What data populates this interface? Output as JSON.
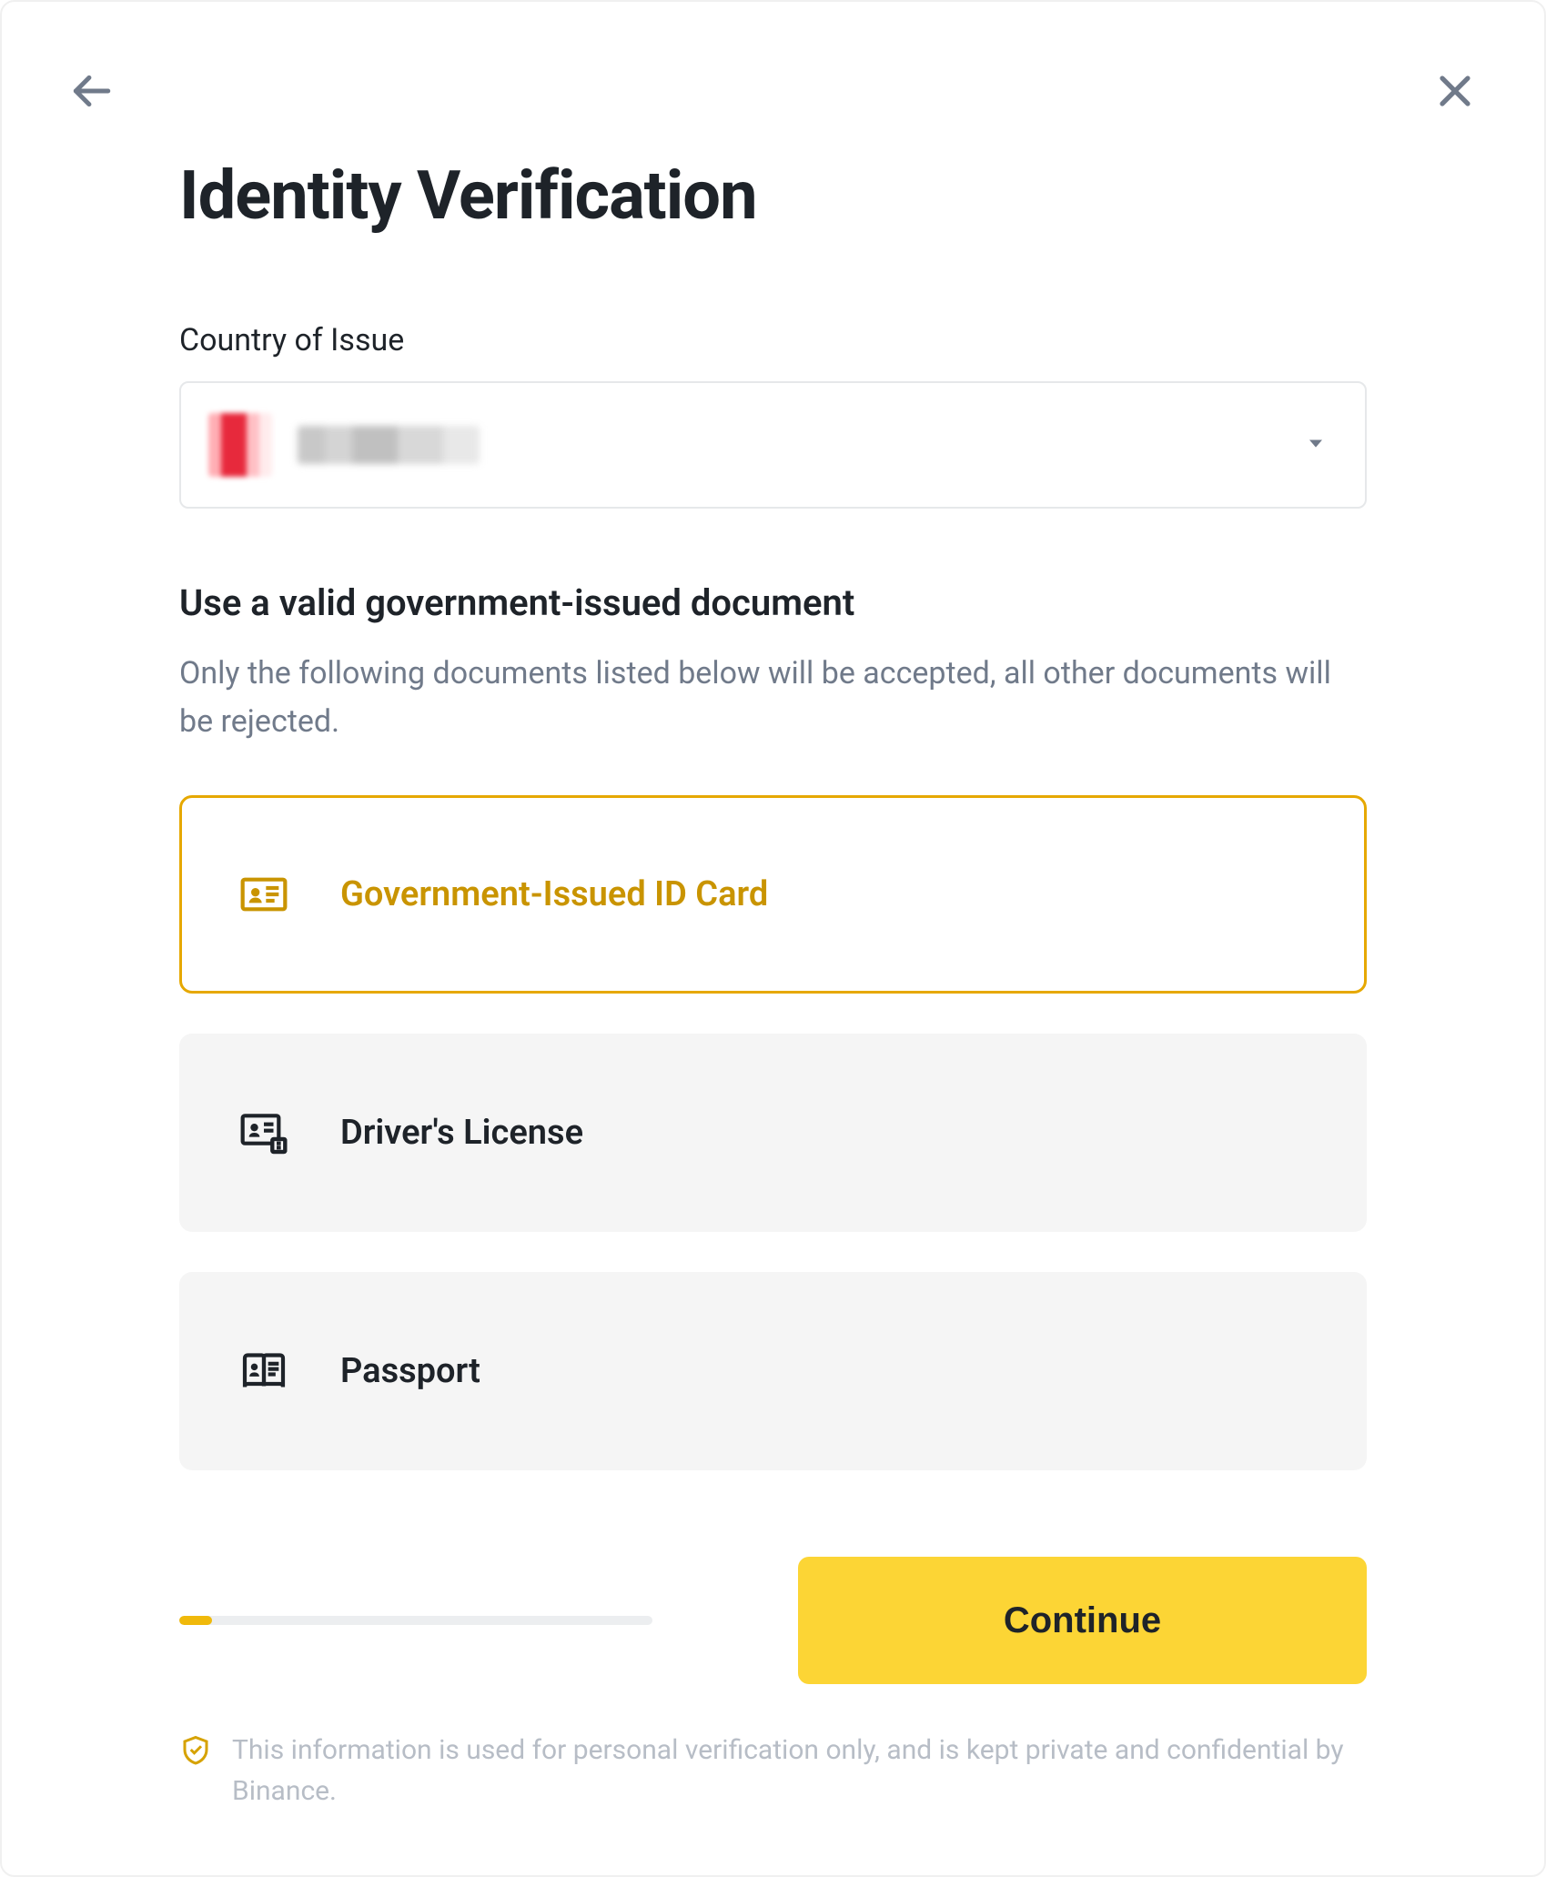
{
  "header": {
    "title": "Identity Verification"
  },
  "country": {
    "label": "Country of Issue",
    "selected_redacted": true
  },
  "documents": {
    "heading": "Use a valid government-issued document",
    "description": "Only the following documents listed below will be accepted, all other documents will be rejected.",
    "options": [
      {
        "id": "id_card",
        "label": "Government-Issued ID Card",
        "selected": true
      },
      {
        "id": "drivers_license",
        "label": "Driver's License",
        "selected": false
      },
      {
        "id": "passport",
        "label": "Passport",
        "selected": false
      }
    ]
  },
  "footer": {
    "continue_label": "Continue",
    "progress_percent": 7,
    "disclaimer": "This information is used for personal verification only, and is kept private and confidential by Binance."
  },
  "colors": {
    "accent": "#f0b90b",
    "accent_dark": "#c99400",
    "button": "#fcd535",
    "text": "#1e2329",
    "muted": "#707a8a"
  }
}
